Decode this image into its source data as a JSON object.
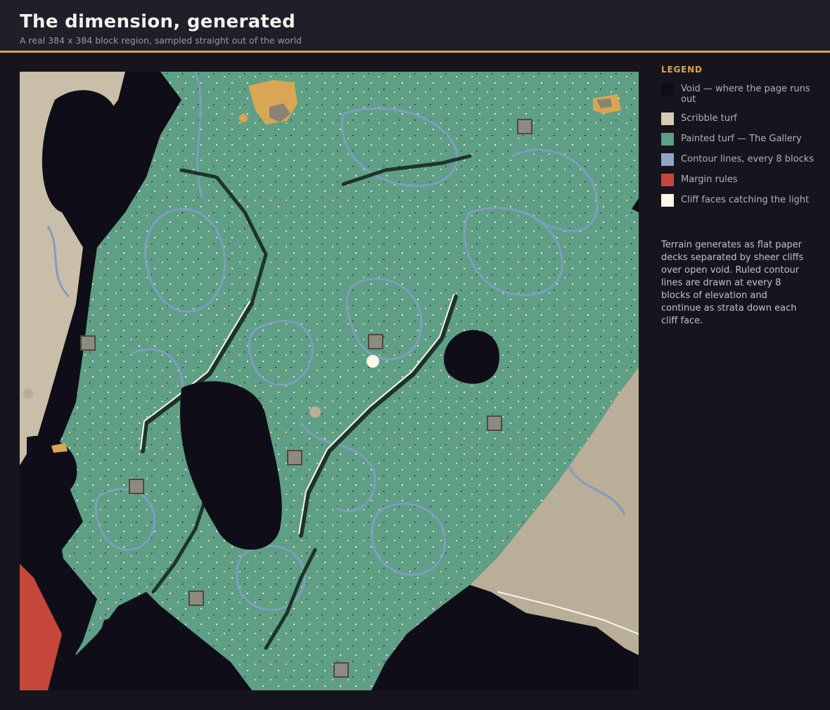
{
  "header": {
    "title": "The dimension, generated",
    "subtitle": "A real 384 x 384 block region, sampled straight out of the world"
  },
  "legend": {
    "title": "LEGEND",
    "items": [
      {
        "label": "Void — where the page runs out",
        "color": "#0f0e18"
      },
      {
        "label": "Scribble turf",
        "color": "#d5cbb6"
      },
      {
        "label": "Painted turf — The Gallery",
        "color": "#5e9f86"
      },
      {
        "label": "Contour lines, every 8 blocks",
        "color": "#8ea7c7"
      },
      {
        "label": "Margin rules",
        "color": "#c5473c"
      },
      {
        "label": "Cliff faces catching the light",
        "color": "#fbf7ea"
      }
    ]
  },
  "description": "Terrain generates as flat paper decks separated by sheer cliffs over open void. Ruled contour lines are drawn at every 8 blocks of elevation and continue as strata down each cliff face.",
  "map": {
    "icon": "terrain-map",
    "colors": {
      "void": "#0f0e18",
      "scribble": "#c9bfa8",
      "painted": "#5e9f86",
      "contour": "#7f9dc0",
      "margin": "#c5473c",
      "cliff": "#fbf7ea",
      "sand": "#d9a654"
    }
  }
}
